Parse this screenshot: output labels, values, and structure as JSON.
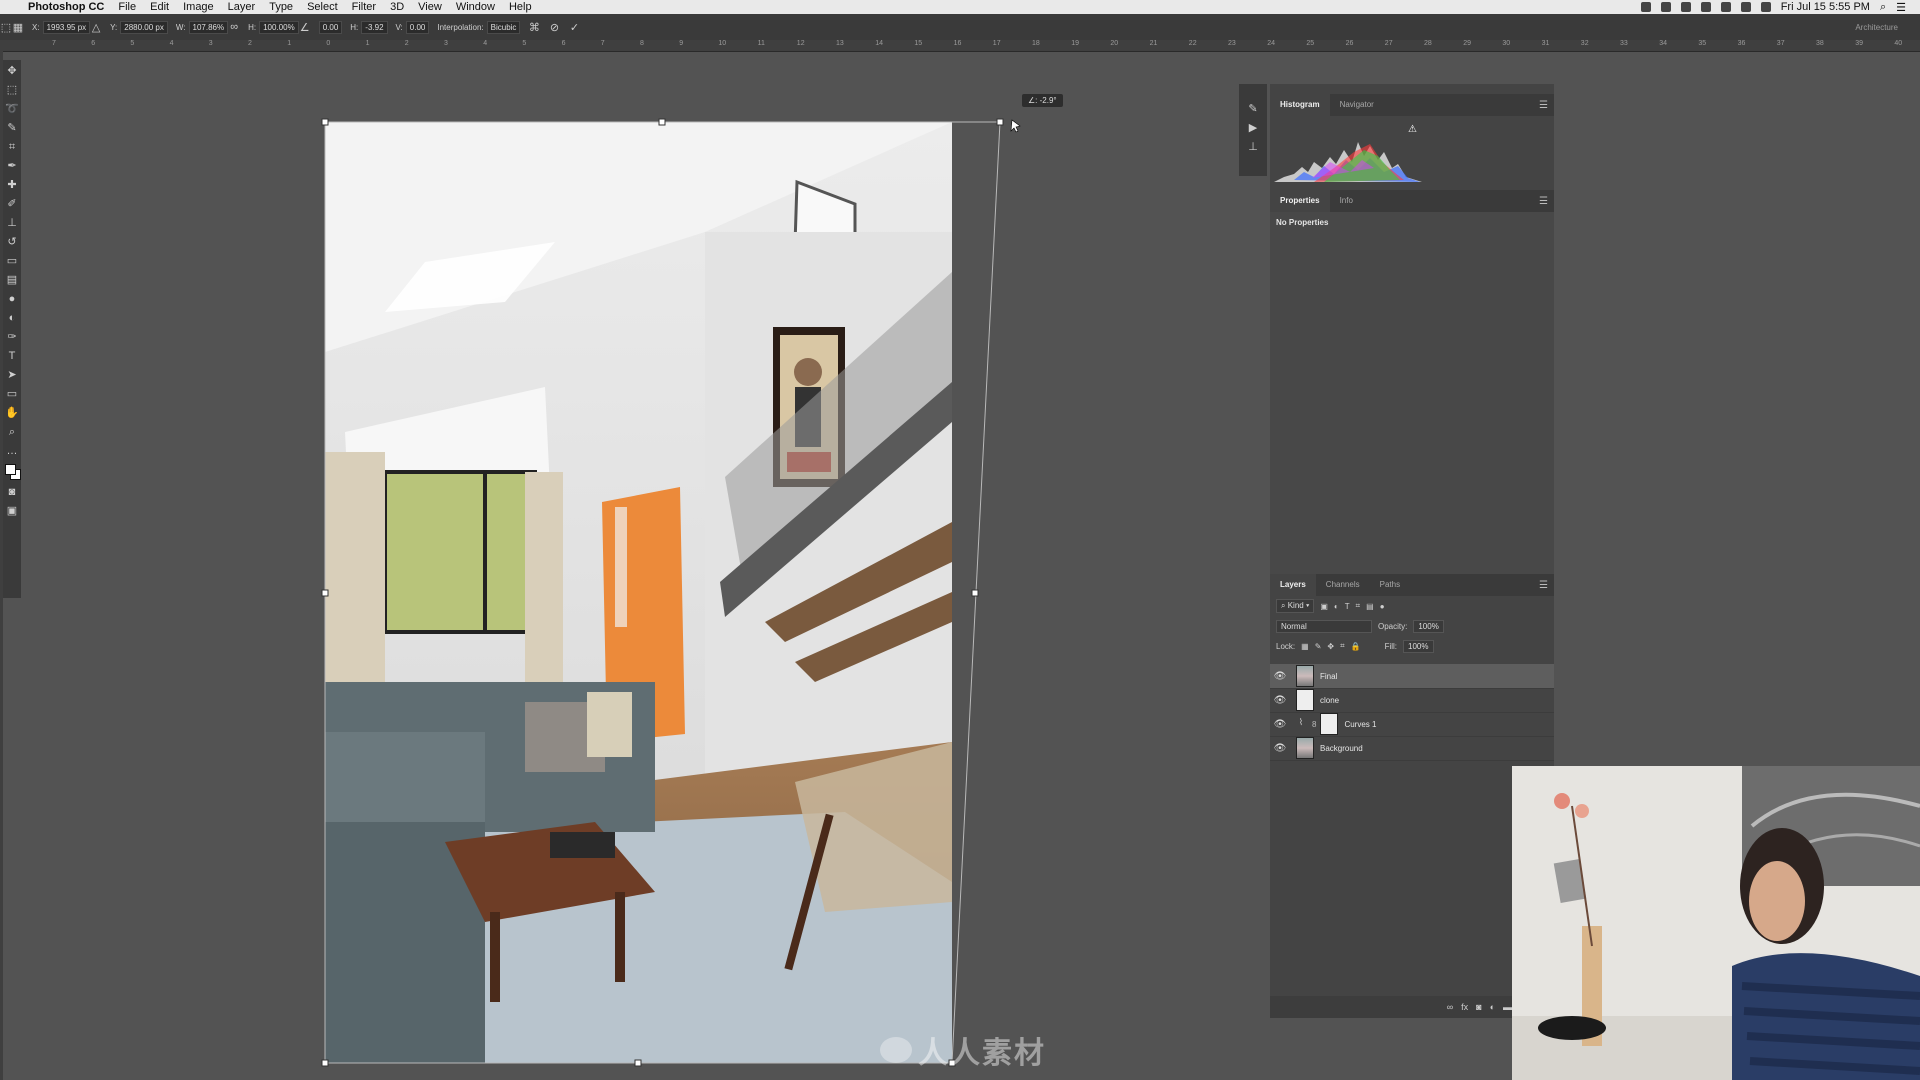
{
  "menubar": {
    "app_name": "Photoshop CC",
    "items": [
      "File",
      "Edit",
      "Image",
      "Layer",
      "Type",
      "Select",
      "Filter",
      "3D",
      "View",
      "Window",
      "Help"
    ],
    "clock": "Fri Jul 15  5:55 PM"
  },
  "options_bar": {
    "x_label": "X:",
    "x_value": "1993.95 px",
    "y_label": "Y:",
    "y_value": "2880.00 px",
    "w_label": "W:",
    "w_value": "107.86%",
    "h_label": "H:",
    "h_value": "100.00%",
    "angle_value": "0.00",
    "hskew_label": "H:",
    "hskew_value": "-3.92",
    "vskew_label": "V:",
    "vskew_value": "0.00",
    "interp_label": "Interpolation:",
    "interp_value": "Bicubic",
    "workspace": "Architecture"
  },
  "ruler_ticks": [
    "7",
    "6",
    "5",
    "4",
    "3",
    "2",
    "1",
    "0",
    "1",
    "2",
    "3",
    "4",
    "5",
    "6",
    "7",
    "8",
    "9",
    "10",
    "11",
    "12",
    "13",
    "14",
    "15",
    "16",
    "17",
    "18",
    "19",
    "20",
    "21",
    "22",
    "23",
    "24",
    "25",
    "26",
    "27",
    "28",
    "29",
    "30",
    "31",
    "32",
    "33",
    "34",
    "35",
    "36",
    "37",
    "38",
    "39",
    "40"
  ],
  "canvas": {
    "angle_readout": "∠: -2.9°",
    "watermark": "人人素材"
  },
  "panels": {
    "histogram_tabs": [
      "Histogram",
      "Navigator"
    ],
    "properties_tabs": [
      "Properties",
      "Info"
    ],
    "no_properties": "No Properties",
    "layers_tabs": [
      "Layers",
      "Channels",
      "Paths"
    ],
    "filter_kind": "Kind",
    "blend_mode": "Normal",
    "opacity_label": "Opacity:",
    "opacity_value": "100%",
    "lock_label": "Lock:",
    "fill_label": "Fill:",
    "fill_value": "100%",
    "layers": [
      {
        "name": "Final"
      },
      {
        "name": "clone"
      },
      {
        "name": "Curves 1"
      },
      {
        "name": "Background"
      }
    ]
  },
  "colors": {
    "menubar_bg": "#e9e9e9",
    "app_bg": "#535353",
    "panel_bg": "#444444",
    "selected_layer": "#5e5e5e",
    "door_orange": "#ec8a3a"
  }
}
